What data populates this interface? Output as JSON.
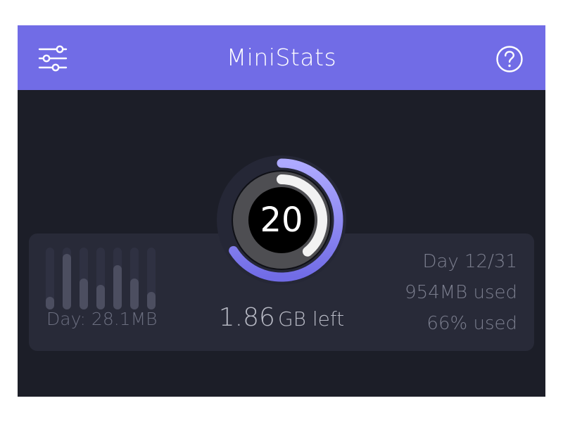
{
  "header": {
    "title": "MiniStats",
    "settings_icon": "sliders-icon",
    "help_icon": "help-circle-icon",
    "background_color": "#716ce6"
  },
  "gauge": {
    "center_value": "20",
    "outer_progress": 0.66,
    "inner_progress": 0.39,
    "outer_color_start": "#aeaaff",
    "outer_color_end": "#716ce6",
    "inner_color": "#f2f2f2"
  },
  "usage": {
    "remaining_value": "1.86",
    "remaining_unit": "GB left",
    "day_usage": "Day: 28.1MB",
    "day_of_period": "Day 12/31",
    "used_amount": "954MB used",
    "used_percent": "66% used"
  },
  "daily_bars": [
    0.2,
    0.9,
    0.5,
    0.4,
    0.72,
    0.5,
    0.28
  ]
}
